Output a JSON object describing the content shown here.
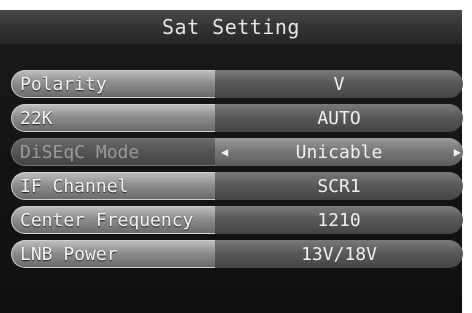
{
  "header": {
    "title": "Sat Setting"
  },
  "menu": {
    "items": [
      {
        "label": "Polarity",
        "value": "V"
      },
      {
        "label": "22K",
        "value": "AUTO"
      },
      {
        "label": "DiSEqC Mode",
        "value": "Unicable"
      },
      {
        "label": "IF Channel",
        "value": "SCR1"
      },
      {
        "label": "Center Frequency",
        "value": "1210"
      },
      {
        "label": "LNB Power",
        "value": "13V/18V"
      }
    ]
  },
  "icons": {
    "left_arrow": "triangle-left-icon",
    "right_arrow": "triangle-right-icon"
  },
  "colors": {
    "background": "#141414",
    "label_highlight": "#bdbdbd",
    "text": "#f0f0f0",
    "disabled_text": "#9a9a9a"
  }
}
